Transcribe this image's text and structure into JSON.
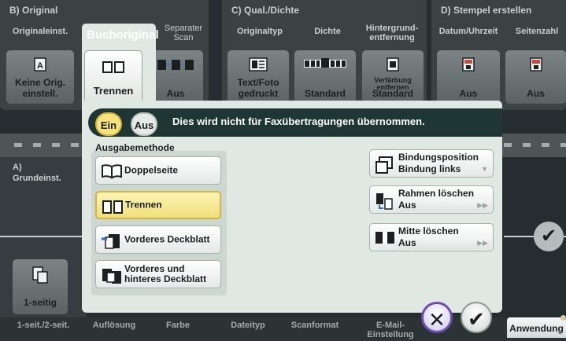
{
  "sections": {
    "b": {
      "title": "B)  Original",
      "col1": "Originaleinst.",
      "tab_active": "Buchoriginal",
      "col3": "Separater Scan",
      "tile1": "Keine Orig. einstell.",
      "tile2": "Trennen",
      "tile3": "Aus"
    },
    "c": {
      "title": "C)  Qual./Dichte",
      "col1": "Originaltyp",
      "col2": "Dichte",
      "col3": "Hintergrund-entfernung",
      "tile1": "Text/Foto gedruckt",
      "tile2": "Standard",
      "tile3_top": "Verfärbung entfernen",
      "tile3": "Standard"
    },
    "d": {
      "title": "D)  Stempel erstellen",
      "col1": "Datum/Uhrzeit",
      "col2": "Seitenzahl",
      "tile1": "Aus",
      "tile2": "Aus"
    }
  },
  "left": {
    "label1": "A)",
    "label2": "Grundeinst.",
    "tile": "1-seitig"
  },
  "popup": {
    "toggle_on": "Ein",
    "toggle_off": "Aus",
    "notice": "Dies wird nicht für Faxübertragungen übernommen.",
    "group_title": "Ausgabemethode",
    "options": [
      "Doppelseite",
      "Trennen",
      "Vorderes Deckblatt",
      "Vorderes und hinteres Deckblatt"
    ],
    "right": [
      {
        "title": "Bindungsposition",
        "value": "Bindung links"
      },
      {
        "title": "Rahmen löschen",
        "value": "Aus"
      },
      {
        "title": "Mitte löschen",
        "value": "Aus"
      }
    ]
  },
  "bottom": [
    "1-seit./2-seit.",
    "Auflösung",
    "Farbe",
    "Dateityp",
    "Scanformat",
    "E-Mail-Einstellung"
  ],
  "application_tab": "Anwendung",
  "colors": {
    "accent": "#f1df7c",
    "header": "#1e3734",
    "cancel_ring": "#6d4db0"
  }
}
